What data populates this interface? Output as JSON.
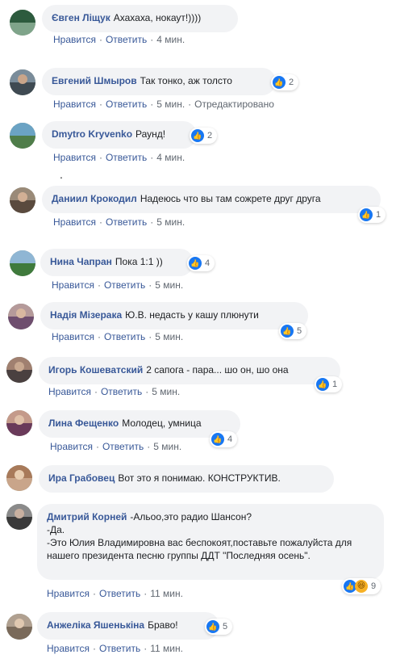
{
  "actions": {
    "like": "Нравится",
    "reply": "Ответить",
    "sep": "·",
    "edited": "Отредактировано"
  },
  "comments": [
    {
      "author": "Євген Ліщук",
      "text": "Ахахаха, нокаут!))))",
      "time": "4 мин.",
      "reactions": null,
      "avatar_top": "#2d5b3e",
      "avatar_bottom": "#7fa48a"
    },
    {
      "author": "Евгений Шмыров",
      "text": "Так тонко, аж толсто",
      "time": "5 мин.",
      "reactions": "2",
      "edited": true,
      "avatar_top": "#7a8c9a",
      "avatar_bottom": "#3f4a52"
    },
    {
      "author": "Dmytro Kryvenko",
      "text": "Раунд!",
      "time": "4 мин.",
      "reactions": "2",
      "avatar_top": "#6ba3c4",
      "avatar_bottom": "#4f7d4a"
    },
    {
      "author": "Даниил Крокодил",
      "text": "Надеюсь что вы там сожрете друг друга",
      "time": "5 мин.",
      "reactions": "1",
      "avatar_top": "#9a8a78",
      "avatar_bottom": "#5a4a3e"
    },
    {
      "author": "Нина Чапран",
      "text": "Пока 1:1 ))",
      "time": "5 мин.",
      "reactions": "4",
      "avatar_top": "#8fb6d4",
      "avatar_bottom": "#3f7a3c"
    },
    {
      "author": "Надія Мізерака",
      "text": "Ю.В. недасть у кашу плюнути",
      "time": "5 мин.",
      "reactions": "5",
      "avatar_top": "#b59a9a",
      "avatar_bottom": "#6e4e6e"
    },
    {
      "author": "Игорь Кошеватский",
      "text": "2 сапога - пара... шо он, шо она",
      "time": "5 мин.",
      "reactions": "1",
      "avatar_top": "#a08070",
      "avatar_bottom": "#4a4040"
    },
    {
      "author": "Лина Фещенко",
      "text": "Молодец, умница",
      "time": "5 мин.",
      "reactions": "4",
      "avatar_top": "#c49a8a",
      "avatar_bottom": "#6a3a5a"
    },
    {
      "author": "Ира Грабовец",
      "text": "Вот это я понимаю. КОНСТРУКТИВ.",
      "time": null,
      "reactions": null,
      "avatar_top": "#a87a5a",
      "avatar_bottom": "#c9a58a"
    },
    {
      "author": "Дмитрий Корней",
      "text": "-Альоо,это радио Шансон?\n-Да.\n-Это Юлия Владимировна вас беспокоят,поставьте пожалуйста для нашего президента песню группы ДДТ \"Последняя осень\".",
      "time": "11 мин.",
      "reactions": "9",
      "haha": true,
      "avatar_top": "#8a8a8a",
      "avatar_bottom": "#3a3a3a"
    },
    {
      "author": "Анжеліка Яшенькіна",
      "text": "Браво!",
      "time": "11 мин.",
      "reactions": "5",
      "avatar_top": "#b0a090",
      "avatar_bottom": "#7a6a5a"
    }
  ],
  "partial_line": "."
}
